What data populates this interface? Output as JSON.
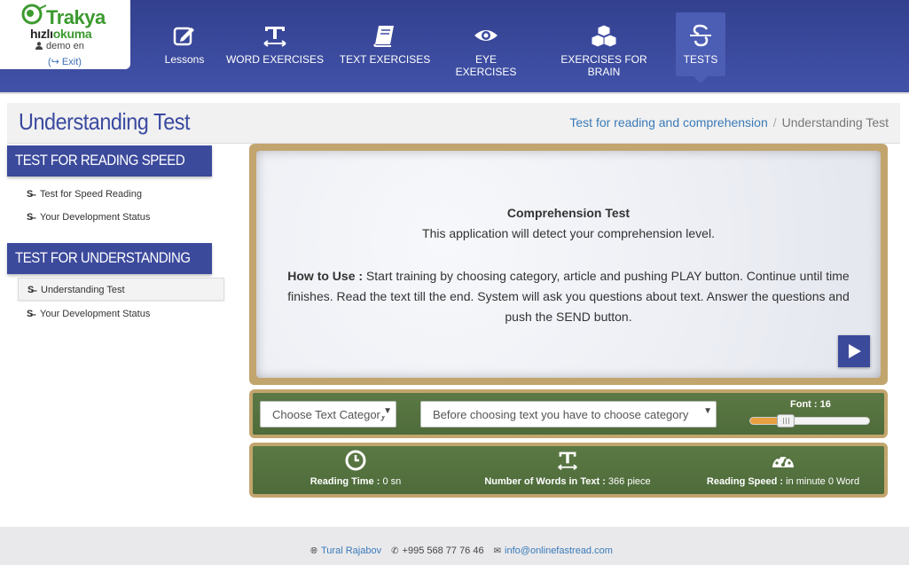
{
  "brand": {
    "logo_main": "Trakya",
    "logo_sub_dark": "hızlı",
    "logo_sub_green": "okuma",
    "user": "demo en",
    "exit": "(↪ Exit)"
  },
  "nav": [
    {
      "label": "Lessons",
      "icon": "pencil-square-icon"
    },
    {
      "label": "WORD EXERCISES",
      "icon": "text-width-icon"
    },
    {
      "label": "TEXT EXERCISES",
      "icon": "book-icon"
    },
    {
      "label": "EYE EXERCISES",
      "icon": "eye-icon"
    },
    {
      "label": "EXERCISES FOR BRAIN",
      "icon": "cubes-icon"
    },
    {
      "label": "TESTS",
      "icon": "strikethrough-s-icon",
      "active": true
    }
  ],
  "page": {
    "title": "Understanding Test",
    "breadcrumb_link": "Test for reading and comprehension",
    "breadcrumb_sep": "/",
    "breadcrumb_current": "Understanding Test"
  },
  "sidebar": {
    "section1_title": "TEST FOR READING SPEED",
    "section1_items": [
      "Test for Speed Reading",
      "Your Development Status"
    ],
    "section2_title": "TEST FOR UNDERSTANDING",
    "section2_items": [
      "Understanding Test",
      "Your Development Status"
    ]
  },
  "intro": {
    "title": "Comprehension Test",
    "subtitle": "This application will detect your comprehension level.",
    "how_label": "How to Use :",
    "how_text": " Start training by choosing category, article and pushing PLAY button. Continue until time finishes. Read the text till the end. System will ask you questions about text. Answer the questions and push the SEND button."
  },
  "controls": {
    "category_select": "Choose Text Category",
    "text_select": "Before choosing text you have to choose category",
    "font_label": "Font : ",
    "font_value": "16",
    "font_level": 0.28
  },
  "stats": {
    "time_label": "Reading Time :",
    "time_value": " 0 sn",
    "words_label": "Number of Words in Text :",
    "words_value": " 366 piece",
    "speed_label": "Reading Speed :",
    "speed_value": " in minute 0 Word"
  },
  "footer": {
    "name": "Tural Rajabov",
    "phone": "+995 568 77 76 46",
    "email": "info@onlinefastread.com"
  },
  "colors": {
    "header": "#3b4aa0",
    "accent": "#3c4a9c",
    "board": "#c2a56e",
    "green": "#53703e",
    "slider": "#e9a040"
  }
}
